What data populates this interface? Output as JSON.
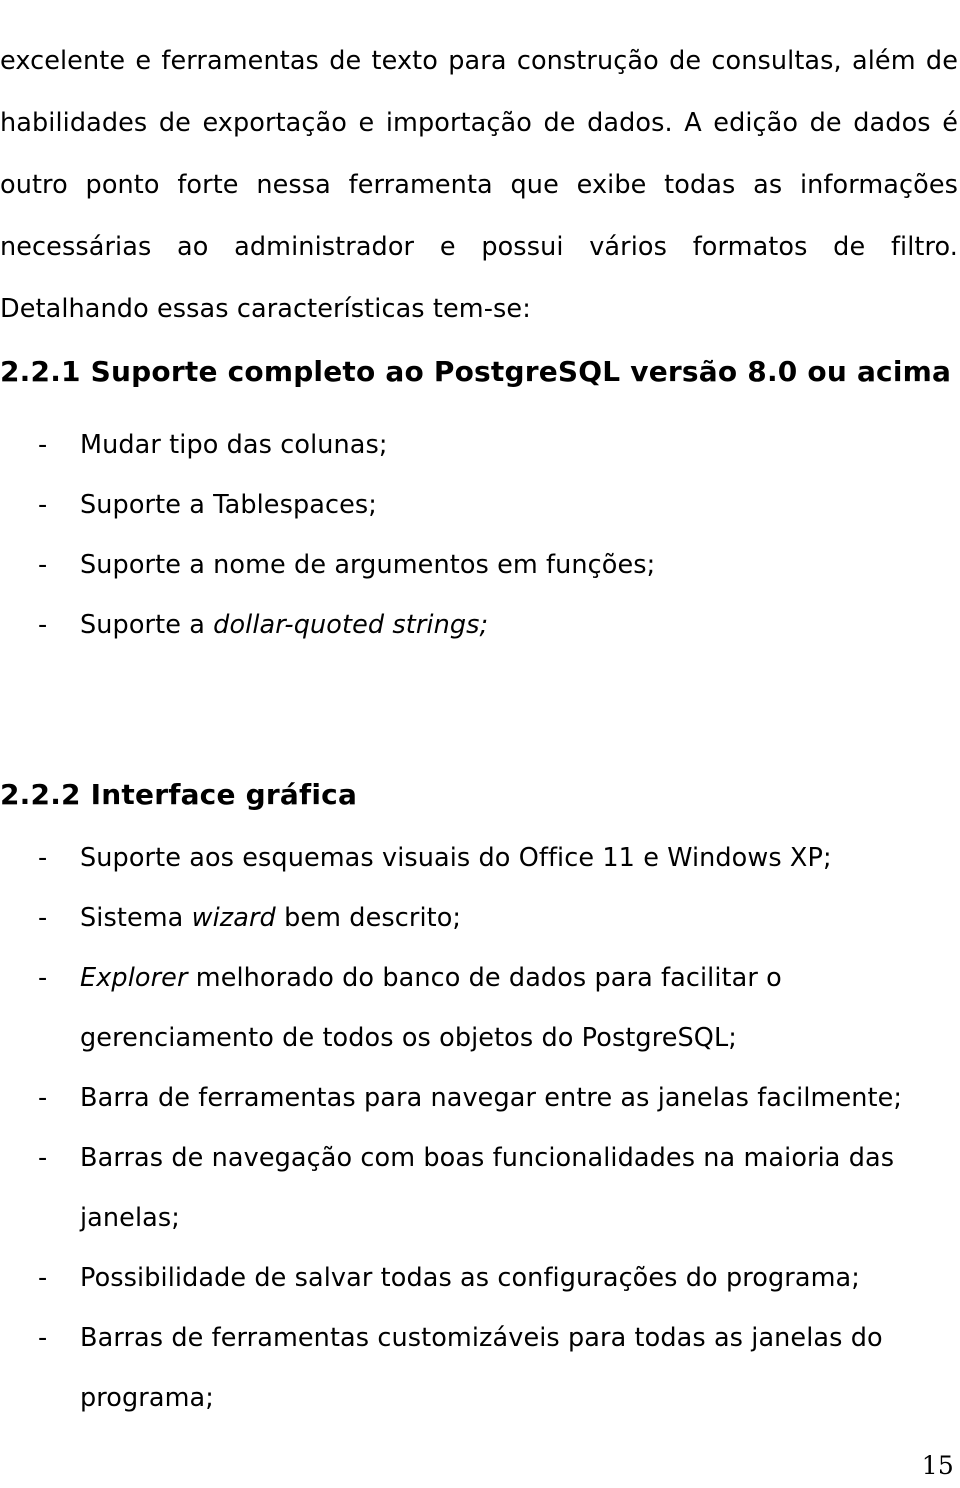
{
  "document": {
    "page_number": "15",
    "body_paragraph": "excelente e ferramentas de texto para construção de consultas,  além de habilidades de exportação e importação de dados. A edição de dados é outro ponto forte nessa ferramenta que exibe todas as informações necessárias ao administrador e possui vários formatos de filtro. Detalhando essas características tem-se:",
    "sections": [
      {
        "heading": "2.2.1 Suporte completo ao PostgreSQL versão 8.0 ou acima",
        "bullet_marker": "-",
        "bullets": [
          {
            "plain_before": "Mudar tipo das colunas;",
            "italic": "",
            "plain_after": ""
          },
          {
            "plain_before": "Suporte a Tablespaces;",
            "italic": "",
            "plain_after": ""
          },
          {
            "plain_before": "Suporte a nome de argumentos em funções;",
            "italic": "",
            "plain_after": ""
          },
          {
            "plain_before": "Suporte a ",
            "italic": "dollar-quoted strings;",
            "plain_after": ""
          }
        ]
      },
      {
        "heading": "2.2.2 Interface gráfica",
        "bullet_marker": "-",
        "bullets": [
          {
            "plain_before": "Suporte aos esquemas visuais do Office 11 e Windows XP;",
            "italic": "",
            "plain_after": ""
          },
          {
            "plain_before": "Sistema ",
            "italic": "wizard",
            "plain_after": " bem descrito;"
          },
          {
            "plain_before": "",
            "italic": "Explorer",
            "plain_after": " melhorado do banco de dados para facilitar o gerenciamento de todos os objetos do PostgreSQL;"
          },
          {
            "plain_before": "Barra de ferramentas para navegar entre as janelas facilmente;",
            "italic": "",
            "plain_after": ""
          },
          {
            "plain_before": "Barras de navegação com boas funcionalidades na maioria das janelas;",
            "italic": "",
            "plain_after": ""
          },
          {
            "plain_before": "Possibilidade de salvar todas as configurações do programa;",
            "italic": "",
            "plain_after": ""
          },
          {
            "plain_before": "Barras de ferramentas customizáveis para todas as janelas do programa;",
            "italic": "",
            "plain_after": ""
          }
        ]
      }
    ]
  }
}
